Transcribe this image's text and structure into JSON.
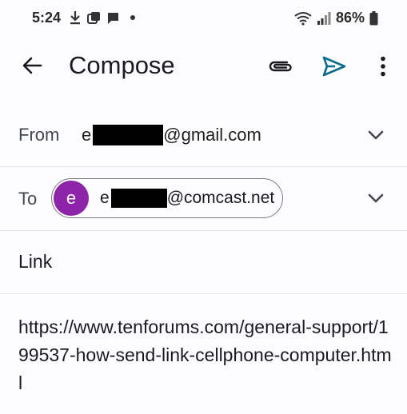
{
  "status_bar": {
    "time": "5:24",
    "battery": "86%"
  },
  "app_bar": {
    "title": "Compose"
  },
  "from": {
    "label": "From",
    "value_prefix": "e",
    "value_suffix": "@gmail.com"
  },
  "to": {
    "label": "To",
    "avatar_letter": "e",
    "value_prefix": "e",
    "value_suffix": "@comcast.net"
  },
  "subject": "Link",
  "body": "https://www.tenforums.com/general-support/199537-how-send-link-cellphone-computer.html",
  "colors": {
    "accent": "#0b57d0",
    "send": "#0b6b8a",
    "avatar": "#8e24aa"
  },
  "icons": [
    "download-icon",
    "app-icon",
    "message-icon",
    "wifi-icon",
    "signal-icon",
    "battery-icon",
    "back-arrow-icon",
    "attach-icon",
    "send-icon",
    "more-vert-icon",
    "chevron-down-icon"
  ]
}
